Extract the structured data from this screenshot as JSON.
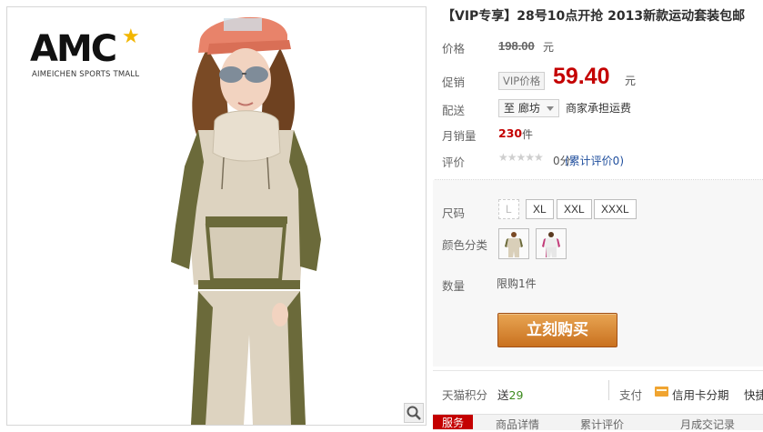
{
  "brand": {
    "logo_text": "AMC",
    "subtitle": "AIMEICHEN SPORTS TMALL"
  },
  "product": {
    "title": "【VIP专享】28号10点开抢 2013新款运动套装包邮"
  },
  "price": {
    "label": "价格",
    "original": "198.00",
    "unit": "元"
  },
  "promo": {
    "label": "促销",
    "vip_badge": "VIP价格",
    "price": "59.40",
    "unit": "元"
  },
  "shipping": {
    "label": "配送",
    "destination": "至 廊坊",
    "note": "商家承担运费"
  },
  "sales": {
    "label": "月销量",
    "count": "230",
    "unit": "件"
  },
  "rating": {
    "label": "评价",
    "stars_filled": 0,
    "stars_total": 5,
    "score": "0分",
    "link": "(累计评价0)"
  },
  "size": {
    "label": "尺码",
    "options": [
      "L",
      "XL",
      "XXL",
      "XXXL"
    ]
  },
  "color_category": {
    "label": "颜色分类"
  },
  "quantity": {
    "label": "数量",
    "text": "限购1件"
  },
  "buy_button": {
    "label": "立刻购买"
  },
  "points": {
    "label": "天猫积分",
    "prefix": "送",
    "value": "29"
  },
  "payment": {
    "label": "支付",
    "credit": "信用卡分期",
    "quick": "快捷"
  },
  "tabs": [
    {
      "label": "服务"
    },
    {
      "label": "商品详情"
    },
    {
      "label": "累计评价"
    },
    {
      "label": "月成交记录"
    }
  ],
  "colors": {
    "price_red": "#c40000",
    "buy_orange": "#d9852f",
    "link_blue": "#1f4e9d"
  }
}
